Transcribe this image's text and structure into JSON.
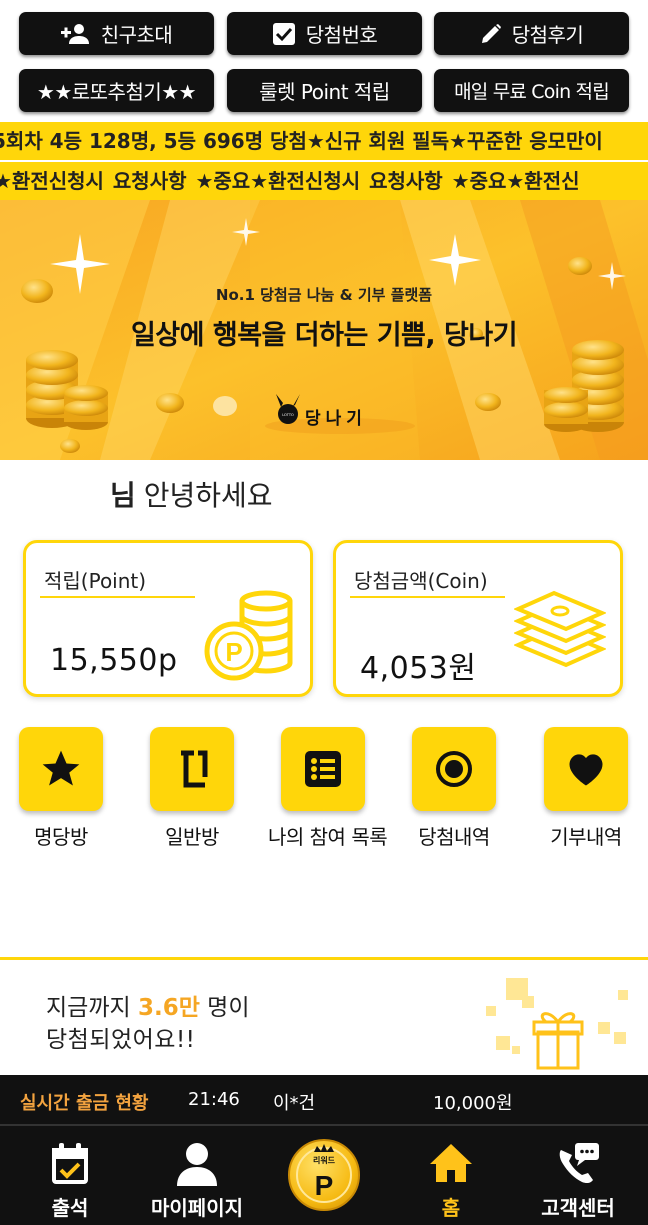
{
  "top_buttons": [
    {
      "label": "친구초대",
      "icon": "add-person-icon"
    },
    {
      "label": "당첨번호",
      "icon": "checkbox-icon"
    },
    {
      "label": "당첨후기",
      "icon": "pencil-icon"
    },
    {
      "label": "★★로또추첨기★★"
    },
    {
      "label": "룰렛 Point 적립"
    },
    {
      "label": "매일 무료 Coin 적립"
    }
  ],
  "ticker": {
    "line1": "5회차 4등 128명, 5등 696명 당첨★신규 회원 필독★꾸준한 응모만이",
    "line2": "★환전신청시 요청사항  ★중요★환전신청시 요청사항  ★중요★환전신"
  },
  "banner": {
    "subtitle": "No.1 당첨금 나눔 & 기부 플랫폼",
    "title": "일상에 행복을 더하는 기쁨, 당나기",
    "brand": "당나기",
    "logo_text": "LOTTO"
  },
  "greeting": {
    "name_suffix": "님",
    "text": "안녕하세요"
  },
  "cards": {
    "point": {
      "title": "적립(Point)",
      "value": "15,550p"
    },
    "coin": {
      "title": "당첨금액(Coin)",
      "value": "4,053원"
    }
  },
  "categories": [
    {
      "label": "명당방",
      "icon": "star-icon"
    },
    {
      "label": "일반방",
      "icon": "bracket-icon"
    },
    {
      "label": "나의 참여 목록",
      "icon": "list-icon"
    },
    {
      "label": "당첨내역",
      "icon": "target-icon"
    },
    {
      "label": "기부내역",
      "icon": "heart-icon"
    }
  ],
  "winners": {
    "prefix": "지금까지",
    "count": "3.6만",
    "suffix": "명이",
    "line2": "당첨되었어요!!"
  },
  "withdraw_status": {
    "title": "실시간 출금 현황",
    "time": "21:46",
    "name": "이*건",
    "amount": "10,000원"
  },
  "bottom_nav": [
    {
      "label": "출석",
      "icon": "calendar-check-icon"
    },
    {
      "label": "마이페이지",
      "icon": "person-icon"
    },
    {
      "label": "리워드",
      "icon": "reward-coin-icon",
      "coin_letter": "P"
    },
    {
      "label": "홈",
      "icon": "home-icon",
      "active": true
    },
    {
      "label": "고객센터",
      "icon": "phone-chat-icon"
    }
  ],
  "colors": {
    "accent": "#FFD60A",
    "dark": "#111111",
    "orange_text": "#F3A33F",
    "active_nav": "#FFC21A"
  }
}
